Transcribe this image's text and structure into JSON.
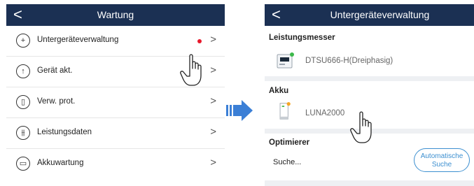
{
  "left": {
    "back_glyph": "<",
    "title": "Wartung",
    "items": [
      {
        "label": "Untergeräteverwaltung",
        "icon": "plus-circle-icon",
        "icon_glyph": "+"
      },
      {
        "label": "Gerät akt.",
        "icon": "upgrade-arrow-icon",
        "icon_glyph": "↑"
      },
      {
        "label": "Verw. prot.",
        "icon": "log-document-icon",
        "icon_glyph": "▯"
      },
      {
        "label": "Leistungsdaten",
        "icon": "sliders-icon",
        "icon_glyph": "⫵"
      },
      {
        "label": "Akkuwartung",
        "icon": "battery-icon",
        "icon_glyph": "▭"
      }
    ],
    "chevron": ">",
    "notification_color": "#e8192c"
  },
  "right": {
    "back_glyph": "<",
    "title": "Untergeräteverwaltung",
    "sections": [
      {
        "title": "Leistungsmesser",
        "device": "DTSU666-H(Dreiphasig)",
        "icon": "power-meter-icon",
        "status_color": "#3cb84a"
      },
      {
        "title": "Akku",
        "device": "LUNA2000",
        "icon": "battery-unit-icon",
        "status_color": "#f5a623"
      },
      {
        "title": "Optimierer",
        "status_text": "Suche...",
        "button_line1": "Automatische",
        "button_line2": "Suche"
      }
    ]
  },
  "colors": {
    "titlebar": "#1b3053",
    "accent": "#3c8fd0",
    "arrow": "#3b7fd6"
  }
}
